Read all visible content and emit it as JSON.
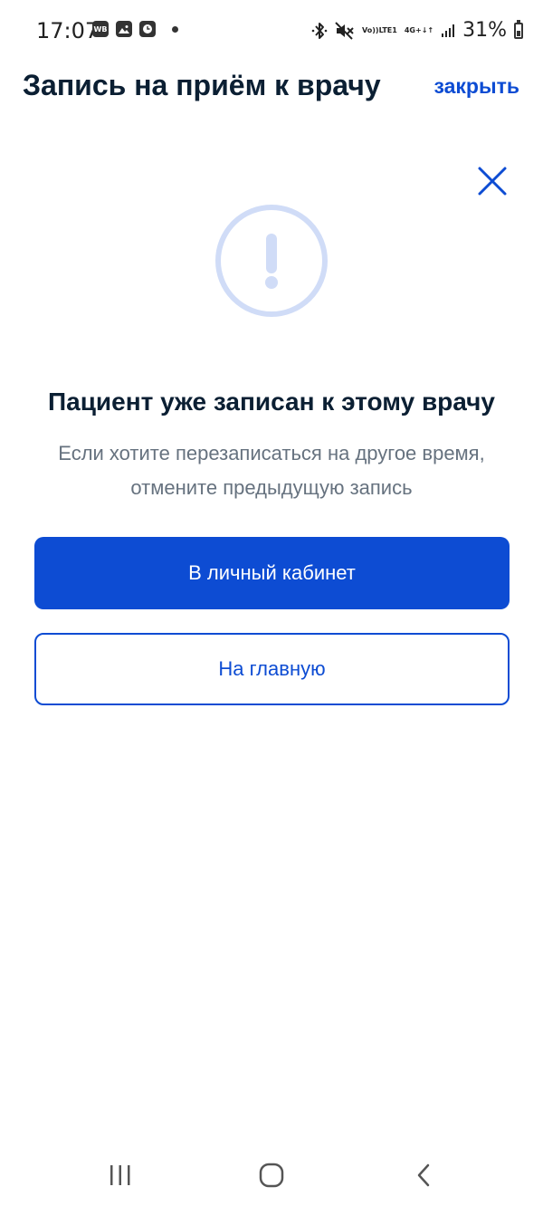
{
  "status_bar": {
    "time": "17:07",
    "notification_icons": [
      "wb-app-icon",
      "gallery-icon",
      "clock-app-icon",
      "more-dot-icon"
    ],
    "wb_label": "WB",
    "volte_line1": "Vo))",
    "volte_line2": "LTE1",
    "network_line1": "4G+",
    "network_line2": "↓↑",
    "battery_percent": "31%"
  },
  "header": {
    "title": "Запись на приём к врачу",
    "close_label": "закрыть"
  },
  "modal": {
    "title": "Пациент уже записан к этому врачу",
    "message": "Если хотите перезаписаться на другое время, отмените предыдущую запись",
    "primary_button": "В личный кабинет",
    "secondary_button": "На главную"
  },
  "colors": {
    "accent": "#0d4cd3",
    "title_text": "#0b1f33",
    "secondary_text": "#66727f",
    "icon_ring": "#d0dcf7"
  },
  "nav_bar": {
    "items": [
      "recent-apps-icon",
      "home-icon",
      "back-icon"
    ]
  }
}
